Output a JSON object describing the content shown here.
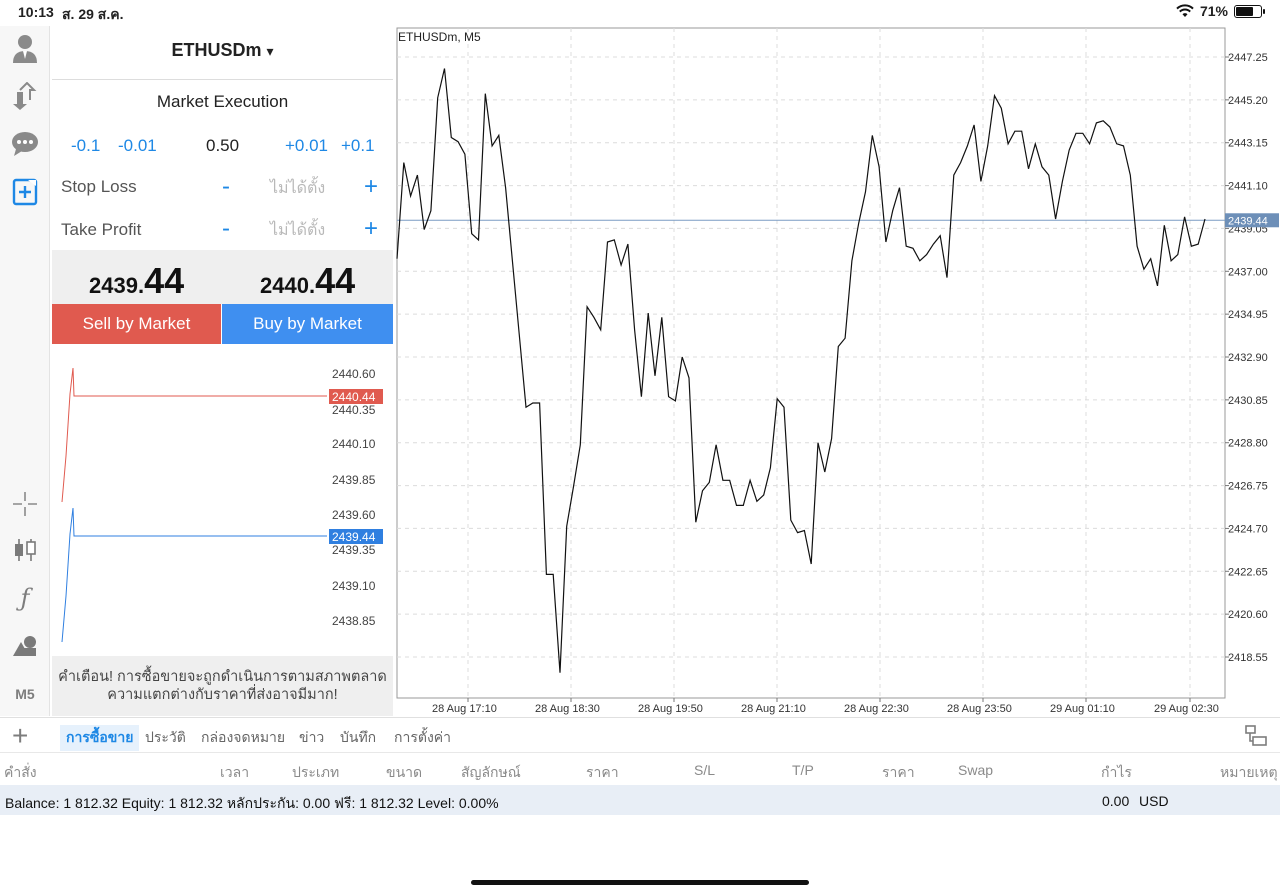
{
  "status": {
    "time": "10:13",
    "date": "ส. 29 ส.ค.",
    "battery": "71%"
  },
  "left_toolbar": {
    "icons": [
      "account-icon",
      "trade-transfer-icon",
      "chat-icon",
      "new-order-icon",
      "crosshair-icon",
      "candlestick-icon",
      "indicator-icon",
      "objects-icon"
    ],
    "timeframe": "M5"
  },
  "order": {
    "symbol": "ETHUSDm",
    "symbol_arrow": "▾",
    "execution": "Market Execution",
    "volume": {
      "minus_large": "-0.1",
      "minus_small": "-0.01",
      "value": "0.50",
      "plus_small": "+0.01",
      "plus_large": "+0.1"
    },
    "stop_loss": {
      "label": "Stop Loss",
      "minus": "-",
      "value": "ไม่ได้ตั้ง",
      "plus": "+"
    },
    "take_profit": {
      "label": "Take Profit",
      "minus": "-",
      "value": "ไม่ได้ตั้ง",
      "plus": "+"
    },
    "bid": {
      "small": "2439.",
      "big": "44"
    },
    "ask": {
      "small": "2440.",
      "big": "44"
    },
    "sell_label": "Sell by Market",
    "buy_label": "Buy by Market",
    "warning_line1": "คำเตือน! การซื้อขายจะถูกดำเนินการตามสภาพตลาด",
    "warning_line2": "ความแตกต่างกับราคาที่ส่งอาจมีมาก!"
  },
  "tick_chart": {
    "ask_scale": [
      "2440.60",
      "2440.35",
      "2440.10",
      "2439.85"
    ],
    "bid_scale": [
      "2439.60",
      "2439.35",
      "2439.10",
      "2438.85"
    ],
    "ask_label": "2440.44",
    "bid_label": "2439.44",
    "ask_color": "#e05a4f",
    "bid_color": "#2f7fe0"
  },
  "chart_data": {
    "type": "line",
    "title": "ETHUSDm, M5",
    "xlabel": "",
    "ylabel": "",
    "ylim": [
      2417,
      2448.5
    ],
    "y_ticks": [
      "2447.25",
      "2445.20",
      "2443.15",
      "2441.10",
      "2439.05",
      "2437.00",
      "2434.95",
      "2432.90",
      "2430.85",
      "2428.80",
      "2426.75",
      "2424.70",
      "2422.65",
      "2420.60",
      "2418.55"
    ],
    "x_ticks": [
      "28 Aug 17:10",
      "28 Aug 18:30",
      "28 Aug 19:50",
      "28 Aug 21:10",
      "28 Aug 22:30",
      "28 Aug 23:50",
      "29 Aug 01:10",
      "29 Aug 02:30"
    ],
    "current_price": "2439.44",
    "grid": true,
    "line_color": "#111111",
    "values": [
      2437.6,
      2442.2,
      2440.6,
      2441.6,
      2439.0,
      2439.9,
      2445.3,
      2446.7,
      2443.4,
      2443.2,
      2442.6,
      2438.8,
      2438.5,
      2445.5,
      2443.0,
      2443.5,
      2441.0,
      2437.5,
      2434.0,
      2430.5,
      2430.7,
      2430.7,
      2422.5,
      2422.5,
      2417.8,
      2424.8,
      2426.7,
      2428.7,
      2435.3,
      2434.8,
      2434.2,
      2438.4,
      2438.5,
      2437.3,
      2438.3,
      2434.2,
      2431.0,
      2435.0,
      2432.0,
      2434.8,
      2431.0,
      2430.8,
      2432.9,
      2431.9,
      2425.0,
      2426.5,
      2426.9,
      2428.7,
      2427.0,
      2427.0,
      2425.8,
      2425.8,
      2427.0,
      2426.0,
      2426.3,
      2427.6,
      2430.9,
      2430.5,
      2425.1,
      2424.5,
      2424.6,
      2423.0,
      2428.8,
      2427.4,
      2429.0,
      2433.4,
      2433.8,
      2437.5,
      2439.3,
      2440.8,
      2443.5,
      2442.0,
      2438.4,
      2439.9,
      2441.0,
      2438.2,
      2438.1,
      2437.5,
      2437.8,
      2438.3,
      2438.7,
      2436.7,
      2441.6,
      2442.2,
      2443.0,
      2444.0,
      2441.3,
      2443.0,
      2445.4,
      2444.8,
      2443.1,
      2443.7,
      2443.7,
      2441.9,
      2443.1,
      2442.0,
      2441.6,
      2439.5,
      2441.3,
      2442.8,
      2443.6,
      2443.6,
      2443.1,
      2444.1,
      2444.2,
      2443.9,
      2443.1,
      2443.0,
      2441.6,
      2438.2,
      2437.1,
      2437.6,
      2436.3,
      2439.2,
      2437.5,
      2437.8,
      2439.6,
      2438.2,
      2438.3,
      2439.5
    ]
  },
  "tabs": {
    "items": [
      "การซื้อขาย",
      "ประวัติ",
      "กล่องจดหมาย",
      "ข่าว",
      "บันทึก",
      "การตั้งค่า"
    ]
  },
  "table_headers": [
    "คำสั่ง",
    "เวลา",
    "ประเภท",
    "ขนาด",
    "สัญลักษณ์",
    "ราคา",
    "S/L",
    "T/P",
    "ราคา",
    "Swap",
    "กำไร",
    "หมายเหตุ"
  ],
  "balance": {
    "text": "Balance: 1 812.32 Equity: 1 812.32 หลักประกัน: 0.00 ฟรี: 1 812.32 Level: 0.00%",
    "profit": "0.00",
    "currency": "USD"
  }
}
